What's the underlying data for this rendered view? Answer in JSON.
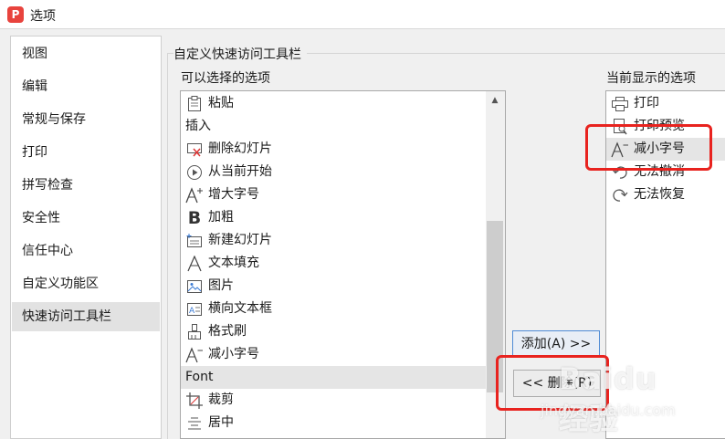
{
  "window": {
    "logo_letter": "P",
    "title": "选项"
  },
  "nav": {
    "items": [
      {
        "label": "视图"
      },
      {
        "label": "编辑"
      },
      {
        "label": "常规与保存"
      },
      {
        "label": "打印"
      },
      {
        "label": "拼写检查"
      },
      {
        "label": "安全性"
      },
      {
        "label": "信任中心"
      },
      {
        "label": "自定义功能区"
      },
      {
        "label": "快速访问工具栏",
        "selected": true
      }
    ]
  },
  "panel": {
    "group_title": "自定义快速访问工具栏",
    "available_label": "可以选择的选项",
    "current_label": "当前显示的选项",
    "available_items": [
      {
        "icon": "paste-icon",
        "label": "粘贴"
      },
      {
        "label": "插入",
        "is_header": true
      },
      {
        "icon": "delete-slide-icon",
        "label": "删除幻灯片"
      },
      {
        "icon": "play-from-current-icon",
        "label": "从当前开始"
      },
      {
        "icon": "increase-font-icon",
        "label": "增大字号"
      },
      {
        "icon": "bold-icon",
        "label": "加粗"
      },
      {
        "icon": "new-slide-icon",
        "label": "新建幻灯片"
      },
      {
        "icon": "text-fill-icon",
        "label": "文本填充"
      },
      {
        "icon": "picture-icon",
        "label": "图片"
      },
      {
        "icon": "horizontal-textbox-icon",
        "label": "横向文本框"
      },
      {
        "icon": "format-painter-icon",
        "label": "格式刷"
      },
      {
        "icon": "decrease-font-icon",
        "label": "减小字号"
      },
      {
        "label": "Font",
        "is_header": true,
        "selected": true
      },
      {
        "icon": "crop-icon",
        "label": "裁剪"
      },
      {
        "icon": "align-center-icon",
        "label": "居中"
      }
    ],
    "current_items": [
      {
        "icon": "print-icon",
        "label": "打印"
      },
      {
        "icon": "print-preview-icon",
        "label": "打印预览"
      },
      {
        "icon": "decrease-font-icon",
        "label": "减小字号",
        "selected": true
      },
      {
        "icon": "undo-icon",
        "label": "无法撤消"
      },
      {
        "icon": "redo-icon",
        "label": "无法恢复"
      }
    ],
    "scrollbar_position": 0.72,
    "add_button": "添加(A) >>",
    "remove_button": "<< 删除(R)"
  },
  "watermark": {
    "logo": "Baidu 经验",
    "url": "jingyan.baidu.com"
  },
  "annotation_color": "#e8231f"
}
